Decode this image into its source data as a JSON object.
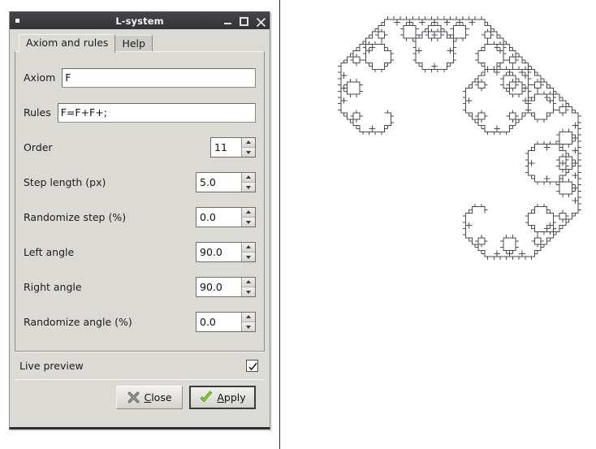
{
  "window": {
    "title": "L-system",
    "icon": "window-menu-icon",
    "buttons": {
      "minimize": "minimize-icon",
      "maximize": "maximize-icon",
      "close": "close-icon"
    }
  },
  "tabs": [
    {
      "label": "Axiom and rules",
      "active": true
    },
    {
      "label": "Help",
      "active": false
    }
  ],
  "fields": {
    "axiom": {
      "label": "Axiom",
      "value": "F",
      "placeholder": ""
    },
    "rules": {
      "label": "Rules",
      "value": "F=F+F+;",
      "placeholder": ""
    },
    "order": {
      "label": "Order",
      "value": "11"
    },
    "step_length": {
      "label": "Step length (px)",
      "value": "5.0",
      "focused": true
    },
    "randomize_step": {
      "label": "Randomize step (%)",
      "value": "0.0"
    },
    "left_angle": {
      "label": "Left angle",
      "value": "90.0"
    },
    "right_angle": {
      "label": "Right angle",
      "value": "90.0"
    },
    "randomize_angle": {
      "label": "Randomize angle (%)",
      "value": "0.0"
    }
  },
  "live_preview": {
    "label": "Live preview",
    "checked": true
  },
  "actions": {
    "close": {
      "label": "Close",
      "mnemonic": "C",
      "icon": "cross-x-icon",
      "icon_color": "#6f6f6f"
    },
    "apply": {
      "label": "Apply",
      "mnemonic": "A",
      "icon": "green-check-icon",
      "icon_color": "#73d216",
      "is_default": true
    }
  },
  "colors": {
    "titlebar": "#3c3c41",
    "dialog_bg": "#dcdad5",
    "entry_bg": "#ffffff",
    "border": "#8d8c89",
    "canvas_bg": "#ffffff",
    "curve_stroke": "#4a4a50",
    "accent_green": "#73d216"
  },
  "preview": {
    "name": "l-system-curve-preview",
    "description": "L-system curve rendered from axiom F with rule F=F+F+; at order 11, 90 degree angles, 5.0 px step"
  }
}
